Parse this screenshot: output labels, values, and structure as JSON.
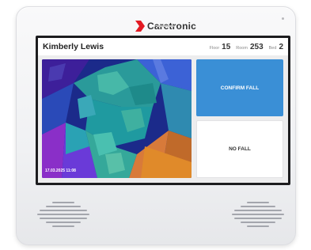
{
  "device": {
    "brand": "Caretronic",
    "accent_color": "#e31b23"
  },
  "screen": {
    "patient_name": "Kimberly Lewis",
    "floor_label": "Floor",
    "floor_value": "15",
    "room_label": "Room",
    "room_value": "253",
    "bed_label": "Bed",
    "bed_value": "2",
    "camera_timestamp": "17.03.2025 11:08",
    "confirm_label": "CONFIRM FALL",
    "confirm_color": "#3a8fd6",
    "nofall_label": "NO FALL"
  }
}
